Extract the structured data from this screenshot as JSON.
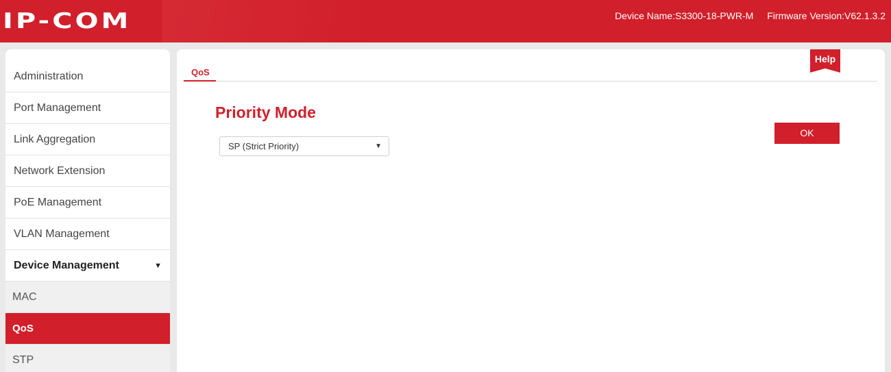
{
  "header": {
    "logo": "IP-COM",
    "device_name": "Device Name:S3300-18-PWR-M",
    "firmware_version": "Firmware Version:V62.1.3.2"
  },
  "sidebar": {
    "items": [
      {
        "label": "Administration"
      },
      {
        "label": "Port Management"
      },
      {
        "label": "Link Aggregation"
      },
      {
        "label": "Network Extension"
      },
      {
        "label": "PoE Management"
      },
      {
        "label": "VLAN Management"
      },
      {
        "label": "Device Management",
        "expanded_caret": "▼"
      }
    ],
    "subitems": [
      {
        "label": "MAC"
      },
      {
        "label": "QoS",
        "active": true
      },
      {
        "label": "STP"
      }
    ]
  },
  "main": {
    "tab": "QoS",
    "help_label": "Help",
    "section_title": "Priority Mode",
    "priority_select": {
      "value": "SP (Strict Priority)",
      "arrow": "▼"
    },
    "ok_label": "OK"
  },
  "colors": {
    "brand_red": "#d11f2b",
    "background": "#e9e9e9"
  }
}
